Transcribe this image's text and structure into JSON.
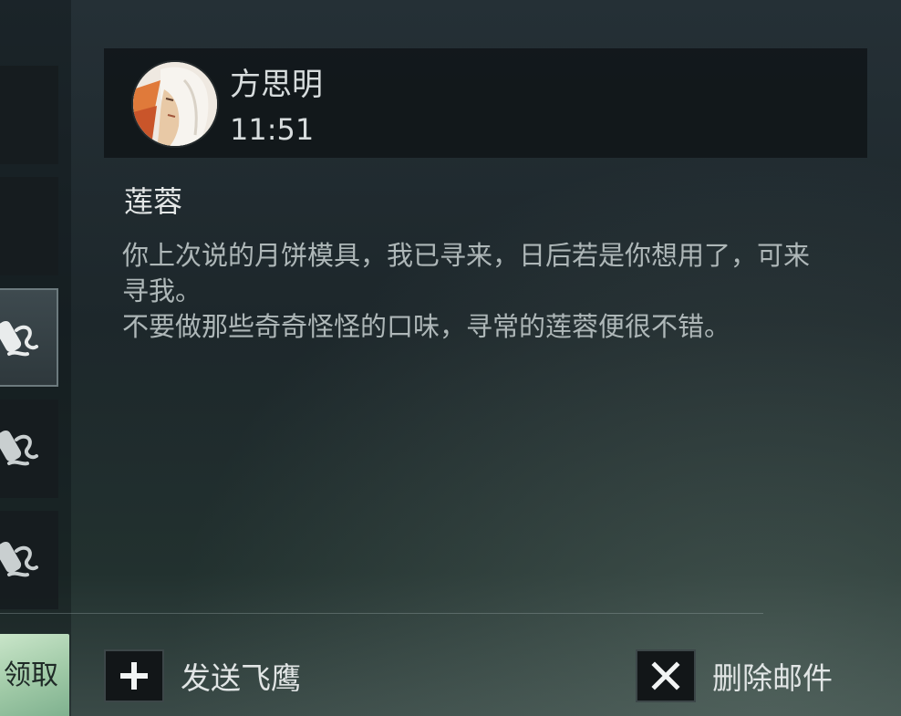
{
  "mail": {
    "sender_name": "方思明",
    "time": "11:51",
    "subject": "莲蓉",
    "body_lines": [
      "你上次说的月饼模具，我已寻来，日后若是你想用了，可来寻我。",
      "不要做那些奇奇怪怪的口味，寻常的莲蓉便很不错。"
    ]
  },
  "left_list": {
    "claim_label": "领取",
    "slots": [
      {
        "icon": "none",
        "selected": false
      },
      {
        "icon": "none",
        "selected": false
      },
      {
        "icon": "scroll-icon",
        "selected": true
      },
      {
        "icon": "scroll-icon",
        "selected": false
      },
      {
        "icon": "scroll-icon",
        "selected": false
      }
    ]
  },
  "actions": {
    "send_label": "发送飞鹰",
    "send_icon": "plus-icon",
    "delete_label": "删除邮件",
    "delete_icon": "close-icon"
  },
  "colors": {
    "claim_button": "#a8d2ae",
    "text_primary": "#e1e5e5",
    "text_body": "#aeb7b8"
  }
}
